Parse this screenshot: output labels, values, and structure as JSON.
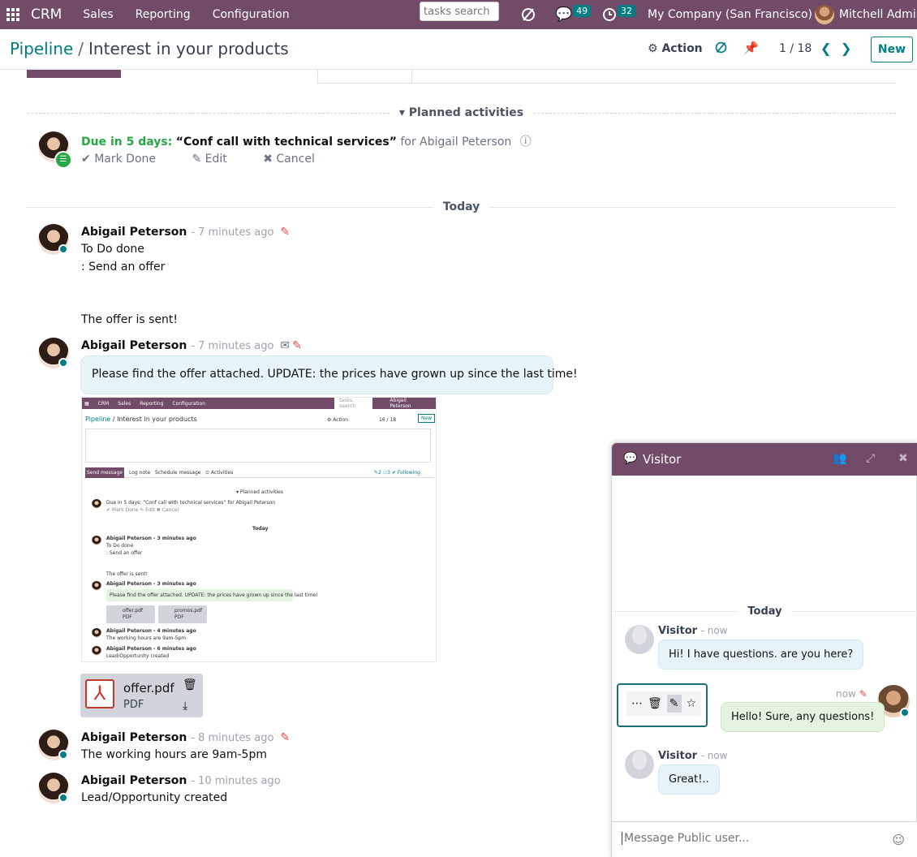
{
  "navbar": {
    "brand": "CRM",
    "menus": [
      "Sales",
      "Reporting",
      "Configuration"
    ],
    "search_placeholder": "tasks search",
    "messages_count": "49",
    "activities_count": "32",
    "company": "My Company (San Francisco)",
    "user": "Mitchell Admin"
  },
  "control": {
    "breadcrumb_parent": "Pipeline",
    "breadcrumb_sep": "/",
    "breadcrumb_current": "Interest in your products",
    "action_label": "Action",
    "pager": "1 / 18",
    "new_label": "New"
  },
  "activities": {
    "header": "Planned activities",
    "due": "Due in 5 days:",
    "title": "“Conf call with technical services”",
    "for_text": "for Abigail Peterson",
    "mark_done": "Mark Done",
    "edit": "Edit",
    "cancel": "Cancel"
  },
  "today_label": "Today",
  "messages": [
    {
      "author": "Abigail Peterson",
      "date": "- 7 minutes ago",
      "lines": [
        "To Do done",
        ": Send an offer",
        "The offer is sent!"
      ]
    },
    {
      "author": "Abigail Peterson",
      "date": "- 7 minutes ago",
      "body": "Please find the offer attached. UPDATE: the prices have grown up since the last time!"
    },
    {
      "author": "Abigail Peterson",
      "date": "- 8 minutes ago",
      "body": "The working hours are 9am-5pm"
    },
    {
      "author": "Abigail Peterson",
      "date": "- 10 minutes ago",
      "body": "Lead/Opportunity created"
    }
  ],
  "attachment": {
    "name": "offer.pdf",
    "type": "PDF"
  },
  "embedded": {
    "nav": [
      "CRM",
      "Sales",
      "Reporting",
      "Configuration"
    ],
    "search": "tasks search",
    "user": "Abigail Peterson",
    "breadcrumb_parent": "Pipeline",
    "breadcrumb_current": "/ Interest in your products",
    "action": "⚙ Action",
    "pager": "16 / 18",
    "new": "New",
    "tabs": [
      "Send message",
      "Log note",
      "Schedule message",
      "⊙ Activities"
    ],
    "followers": "✎2  ⚇3  ✔ Following",
    "planned": "▾ Planned activities",
    "due": "Due in 5 days: “Conf call with technical services” for Abigail Peterson",
    "due_actions": "✔ Mark Done   ✎ Edit   ✖ Cancel",
    "today": "Today",
    "m1_author": "Abigail Peterson - 3 minutes ago",
    "m1_l1": "To Do done",
    "m1_l2": ": Send an offer",
    "m1_l3": "The offer is sent!",
    "m2_author": "Abigail Peterson - 3 minutes ago",
    "m2_body": "Please find the offer attached. UPDATE: the prices have grown up since the last time!",
    "att1": "offer.pdf",
    "att2": "promos.pdf",
    "att_type": "PDF",
    "m3_author": "Abigail Peterson - 4 minutes ago",
    "m3_body": "The working hours are 9am-5pm",
    "m4_author": "Abigail Peterson - 6 minutes ago",
    "m4_body": "Lead/Opportunity created"
  },
  "chat": {
    "title": "Visitor",
    "today": "Today",
    "messages": [
      {
        "author": "Visitor",
        "date": "- now",
        "body": "Hi! I have questions. are you here?"
      },
      {
        "author": "",
        "date": "now",
        "body": "Hello! Sure, any questions!"
      },
      {
        "author": "Visitor",
        "date": "- now",
        "body": "Great!.."
      }
    ],
    "composer_placeholder": "Message Public user..."
  },
  "icons": {
    "apps": "grid-icon",
    "activity": "clock-icon",
    "messages": "chat-icon",
    "pdf": "file-pdf-icon",
    "trash": "trash-icon",
    "download": "download-icon"
  },
  "colors": {
    "brand": "#714b67",
    "accent": "#017e84",
    "due": "#28a745",
    "edit": "#e04a4a"
  }
}
